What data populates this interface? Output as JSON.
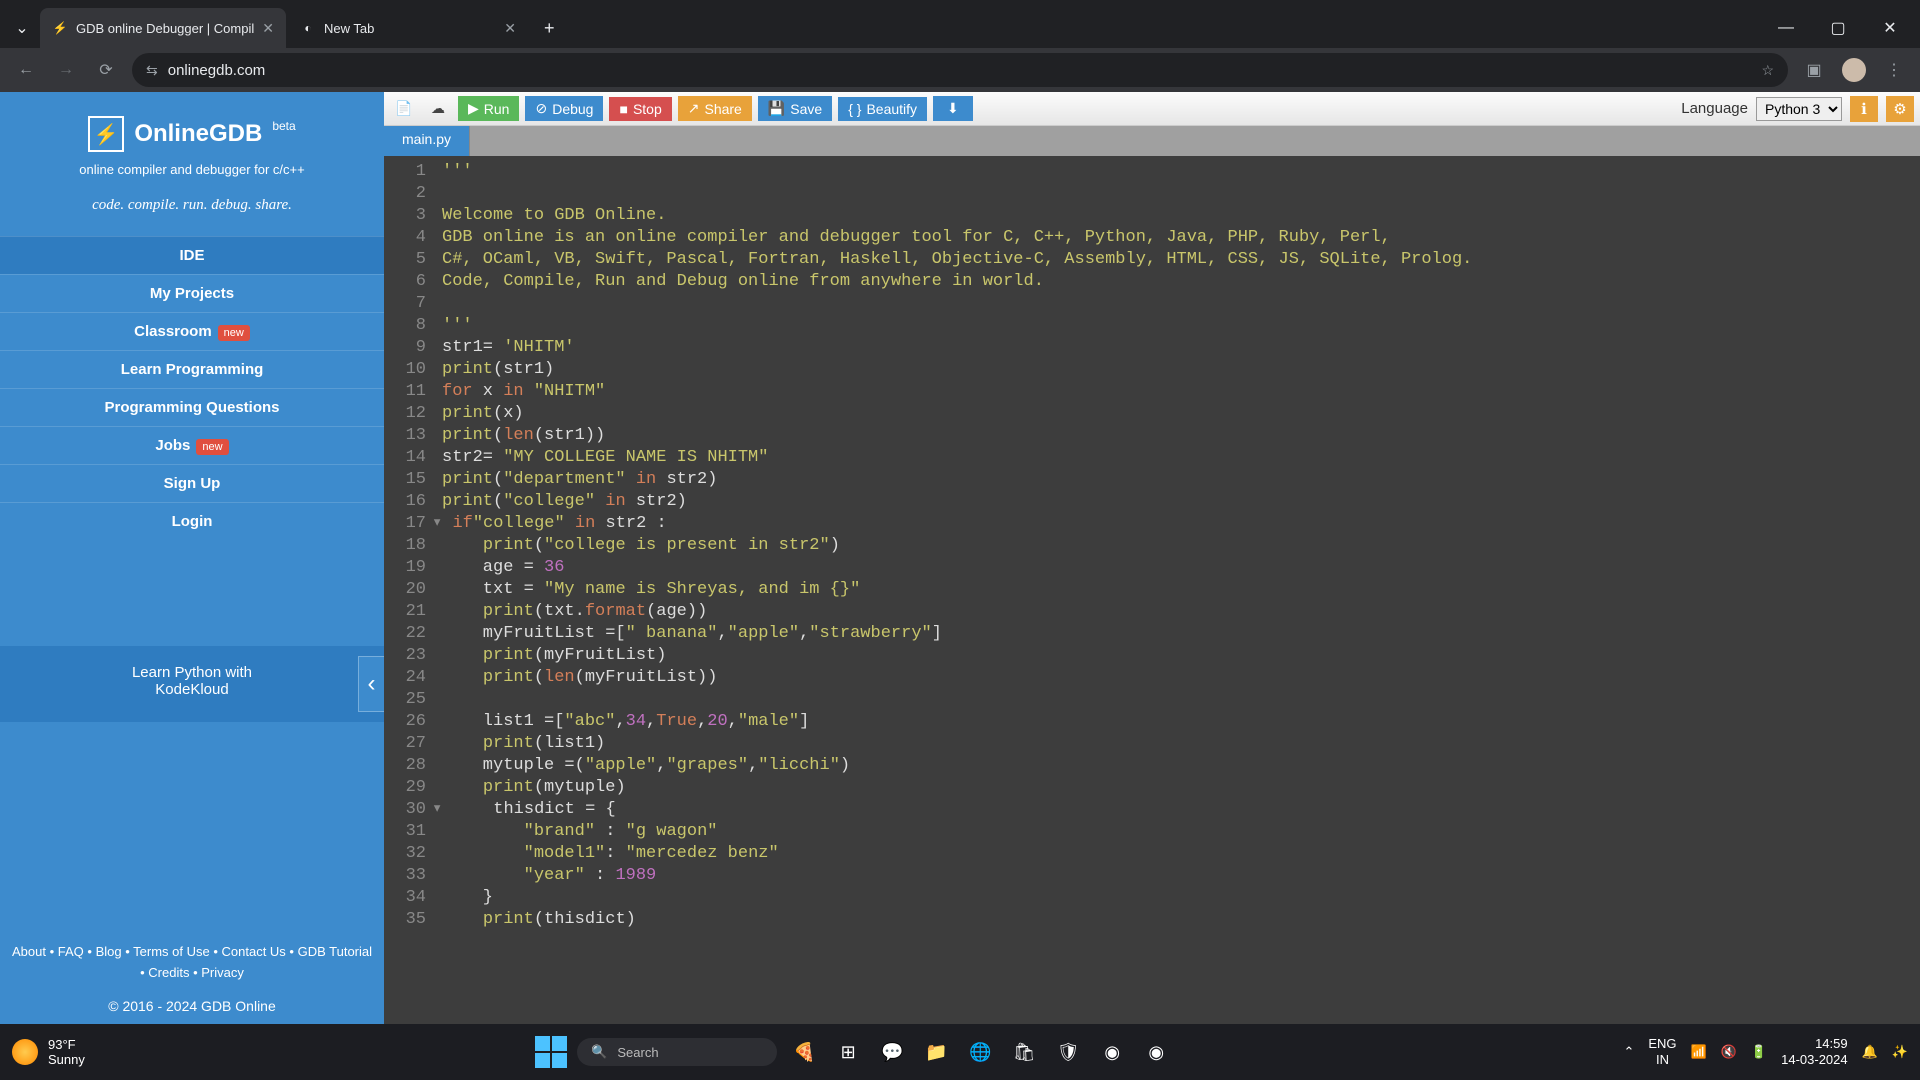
{
  "browser": {
    "tabs": [
      {
        "title": "GDB online Debugger | Compil",
        "active": true,
        "favicon": "⚡"
      },
      {
        "title": "New Tab",
        "active": false,
        "favicon": "◐"
      }
    ],
    "url": "onlinegdb.com"
  },
  "sidebar": {
    "title": "OnlineGDB",
    "beta": "beta",
    "subtitle1": "online compiler and debugger for c/c++",
    "subtitle2": "code. compile. run. debug. share.",
    "items": [
      {
        "label": "IDE",
        "new": false
      },
      {
        "label": "My Projects",
        "new": false
      },
      {
        "label": "Classroom",
        "new": true
      },
      {
        "label": "Learn Programming",
        "new": false
      },
      {
        "label": "Programming Questions",
        "new": false
      },
      {
        "label": "Jobs",
        "new": true
      },
      {
        "label": "Sign Up",
        "new": false
      },
      {
        "label": "Login",
        "new": false
      }
    ],
    "new_badge": "new",
    "promo1": "Learn Python with",
    "promo2": "KodeKloud",
    "footer": {
      "about": "About",
      "faq": "FAQ",
      "blog": "Blog",
      "terms": "Terms of Use",
      "contact": "Contact Us",
      "tutorial": "GDB Tutorial",
      "credits": "Credits",
      "privacy": "Privacy"
    },
    "copyright": "© 2016 - 2024 GDB Online"
  },
  "toolbar": {
    "run": "Run",
    "debug": "Debug",
    "stop": "Stop",
    "share": "Share",
    "save": "Save",
    "beautify": "Beautify",
    "language_label": "Language",
    "language_value": "Python 3"
  },
  "file_tab": "main.py",
  "code": {
    "lines": [
      {
        "n": 1,
        "html": "<span class='tok-str'>'''</span>"
      },
      {
        "n": 2,
        "html": ""
      },
      {
        "n": 3,
        "html": "<span class='tok-str'>Welcome to GDB Online.</span>"
      },
      {
        "n": 4,
        "html": "<span class='tok-str'>GDB online is an online compiler and debugger tool for C, C++, Python, Java, PHP, Ruby, Perl,</span>"
      },
      {
        "n": 5,
        "html": "<span class='tok-str'>C#, OCaml, VB, Swift, Pascal, Fortran, Haskell, Objective-C, Assembly, HTML, CSS, JS, SQLite, Prolog.</span>"
      },
      {
        "n": 6,
        "html": "<span class='tok-str'>Code, Compile, Run and Debug online from anywhere in world.</span>"
      },
      {
        "n": 7,
        "html": ""
      },
      {
        "n": 8,
        "html": "<span class='tok-str'>'''</span>"
      },
      {
        "n": 9,
        "html": "str1= <span class='tok-str'>'NHITM'</span>"
      },
      {
        "n": 10,
        "html": "<span class='tok-fn'>print</span>(str1)"
      },
      {
        "n": 11,
        "html": "<span class='tok-kw'>for</span> x <span class='tok-kw'>in</span> <span class='tok-str'>\"NHITM\"</span>"
      },
      {
        "n": 12,
        "html": "<span class='tok-fn'>print</span>(x)"
      },
      {
        "n": 13,
        "html": "<span class='tok-fn'>print</span>(<span class='tok-builtin'>len</span>(str1))"
      },
      {
        "n": 14,
        "html": "str2= <span class='tok-str'>\"MY COLLEGE NAME IS NHITM\"</span>"
      },
      {
        "n": 15,
        "html": "<span class='tok-fn'>print</span>(<span class='tok-str'>\"department\"</span> <span class='tok-kw'>in</span> str2)"
      },
      {
        "n": 16,
        "html": "<span class='tok-fn'>print</span>(<span class='tok-str'>\"college\"</span> <span class='tok-kw'>in</span> str2)"
      },
      {
        "n": 17,
        "html": "<span class='tok-kw'>if</span><span class='tok-str'>\"college\"</span> <span class='tok-kw'>in</span> str2 :",
        "fold": true
      },
      {
        "n": 18,
        "html": "    <span class='tok-fn'>print</span>(<span class='tok-str'>\"college is present in str2\"</span>)"
      },
      {
        "n": 19,
        "html": "    age = <span class='tok-num'>36</span>"
      },
      {
        "n": 20,
        "html": "    txt = <span class='tok-str'>\"My name is Shreyas, and im {}\"</span>"
      },
      {
        "n": 21,
        "html": "    <span class='tok-fn'>print</span>(txt.<span class='tok-builtin'>format</span>(age))"
      },
      {
        "n": 22,
        "html": "    myFruitList =[<span class='tok-str'>\" banana\"</span>,<span class='tok-str'>\"apple\"</span>,<span class='tok-str'>\"strawberry\"</span>]"
      },
      {
        "n": 23,
        "html": "    <span class='tok-fn'>print</span>(myFruitList)"
      },
      {
        "n": 24,
        "html": "    <span class='tok-fn'>print</span>(<span class='tok-builtin'>len</span>(myFruitList))"
      },
      {
        "n": 25,
        "html": ""
      },
      {
        "n": 26,
        "html": "    list1 =[<span class='tok-str'>\"abc\"</span>,<span class='tok-num'>34</span>,<span class='tok-bool'>True</span>,<span class='tok-num'>20</span>,<span class='tok-str'>\"male\"</span>]"
      },
      {
        "n": 27,
        "html": "    <span class='tok-fn'>print</span>(list1)"
      },
      {
        "n": 28,
        "html": "    mytuple =(<span class='tok-str'>\"apple\"</span>,<span class='tok-str'>\"grapes\"</span>,<span class='tok-str'>\"licchi\"</span>)"
      },
      {
        "n": 29,
        "html": "    <span class='tok-fn'>print</span>(mytuple)"
      },
      {
        "n": 30,
        "html": "    thisdict = {",
        "fold": true
      },
      {
        "n": 31,
        "html": "        <span class='tok-str'>\"brand\"</span> : <span class='tok-str'>\"g wagon\"</span>"
      },
      {
        "n": 32,
        "html": "        <span class='tok-str'>\"model1\"</span>: <span class='tok-str'>\"mercedez benz\"</span>"
      },
      {
        "n": 33,
        "html": "        <span class='tok-str'>\"year\"</span> : <span class='tok-num'>1989</span>"
      },
      {
        "n": 34,
        "html": "    }"
      },
      {
        "n": 35,
        "html": "    <span class='tok-fn'>print</span>(thisdict)"
      }
    ]
  },
  "taskbar": {
    "weather_temp": "93°F",
    "weather_desc": "Sunny",
    "search_placeholder": "Search",
    "lang1": "ENG",
    "lang2": "IN",
    "time": "14:59",
    "date": "14-03-2024"
  }
}
